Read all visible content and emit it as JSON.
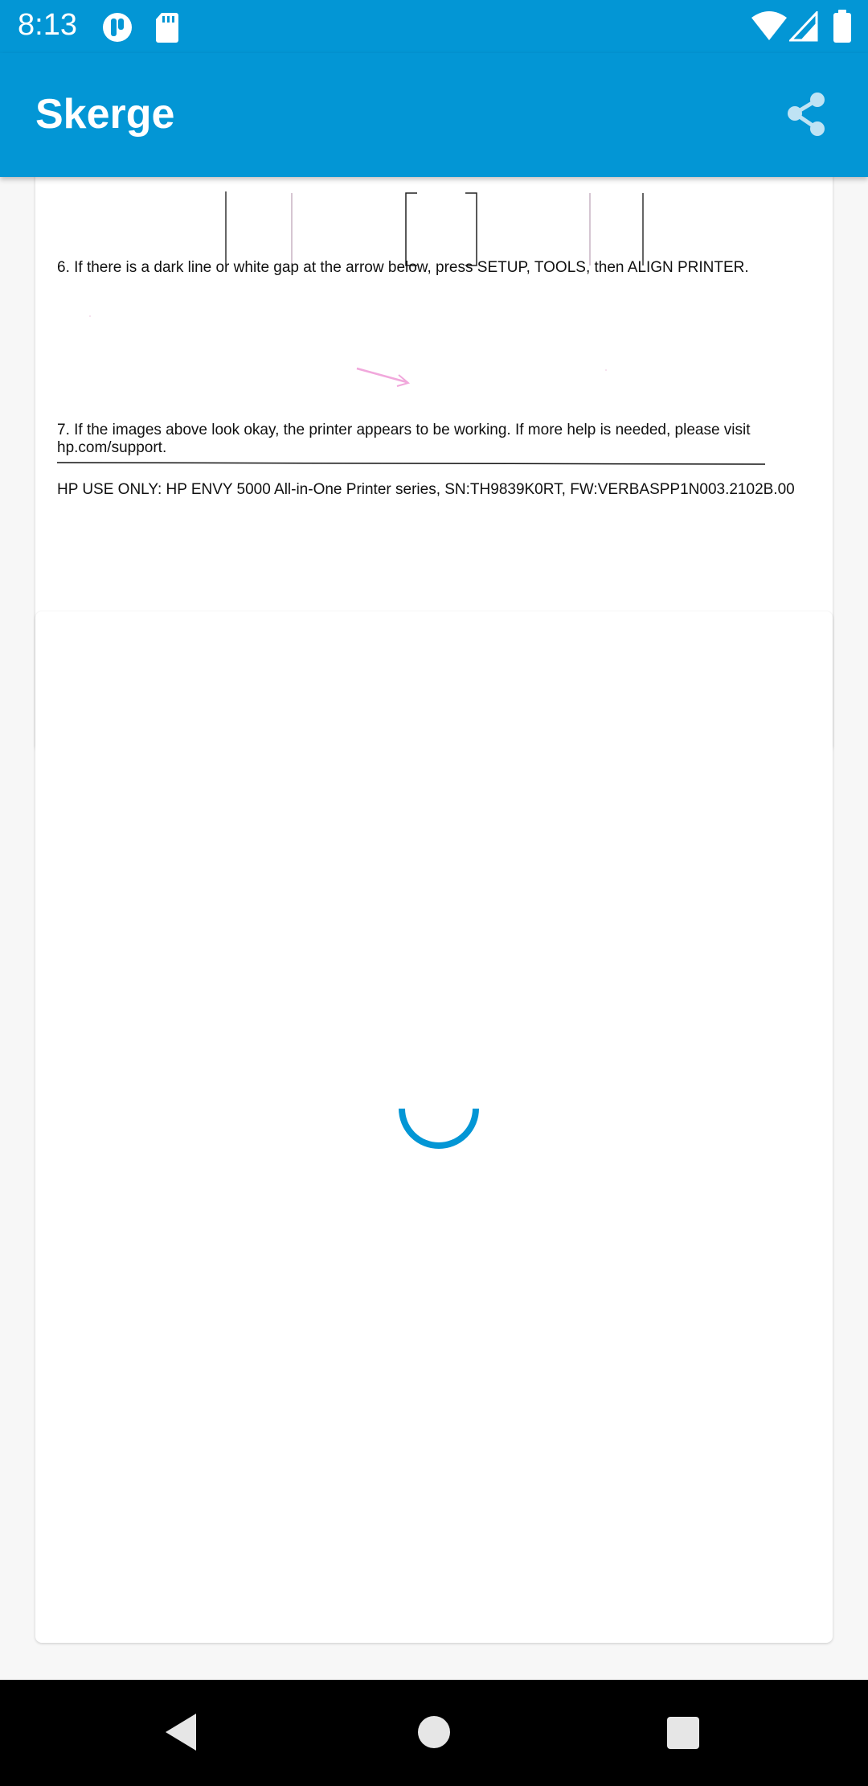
{
  "status_bar": {
    "time": "8:13",
    "icons": [
      "app-notification-icon",
      "sd-card-icon",
      "wifi-icon",
      "signal-icon",
      "battery-icon"
    ]
  },
  "app_bar": {
    "title": "Skerge",
    "actions": [
      "share-icon"
    ]
  },
  "document": {
    "step6": "6. If there is a dark line or white gap at the arrow below, press SETUP, TOOLS, then ALIGN PRINTER.",
    "step7_line1": "7. If the images above look okay, the printer appears to be working. If more help is needed, please visit",
    "step7_line2": "hp.com/support.",
    "footer": "HP USE ONLY: HP ENVY 5000 All-in-One Printer series, SN:TH9839K0RT, FW:VERBASPP1N003.2102B.00"
  },
  "loading": {
    "state": "loading",
    "spinner_icon": "progress-spinner-icon"
  },
  "nav_bar": {
    "buttons": [
      "back-icon",
      "home-icon",
      "recents-icon"
    ]
  },
  "colors": {
    "primary": "#0396d5",
    "status_bar": "#0396d5",
    "spinner": "#0396d5",
    "nav_bar": "#000000",
    "background": "#f7f7f7"
  }
}
